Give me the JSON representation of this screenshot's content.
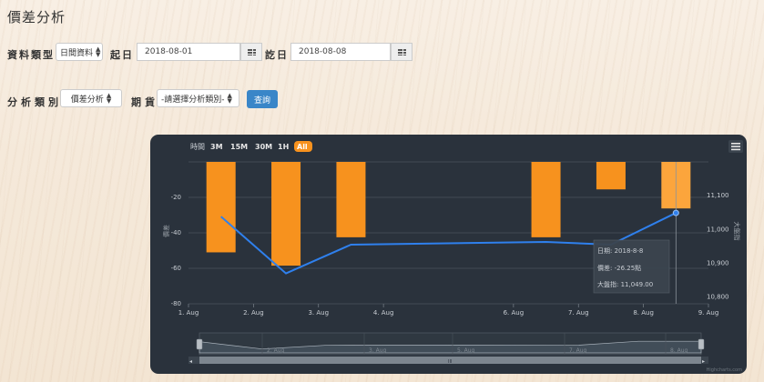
{
  "page": {
    "title": "價差分析"
  },
  "form": {
    "row1": {
      "data_type_label": "資料類型",
      "data_type_value": "日間資料",
      "start_label": "起日",
      "start_value": "2018-08-01",
      "end_label": "訖日",
      "end_value": "2018-08-08"
    },
    "row2": {
      "category_label": "分析類別",
      "category_value": "價差分析",
      "futures_label": "期貨",
      "futures_value": "-請選擇分析類別-",
      "query_label": "查詢"
    }
  },
  "colors": {
    "chart_bg": "#2a323c",
    "bar": "#f7921e",
    "bar_highlight": "#fca53c",
    "line": "#2f80ed",
    "button": "#3a86c8",
    "range_active": "#f7921e"
  },
  "chart": {
    "range_label": "時間",
    "range_buttons": [
      "3M",
      "15M",
      "30M",
      "1H",
      "All"
    ],
    "menu_icon": "hamburger-icon",
    "left_axis_title": "價差",
    "right_axis_title": "大盤指",
    "tooltip": {
      "line1": "日期: 2018-8-8",
      "line2": "價差: -26.25點",
      "line3": "大盤指: 11,049.00"
    },
    "navigator_ticks": [
      "2. Aug",
      "3. Aug",
      "5. Aug",
      "7. Aug",
      "8. Aug"
    ],
    "credit": "Highcharts.com"
  },
  "chart_data": {
    "type": "bar",
    "x_ticks": [
      "1. Aug",
      "2. Aug",
      "3. Aug",
      "4. Aug",
      "6. Aug",
      "7. Aug",
      "8. Aug",
      "9. Aug"
    ],
    "left_ticks": [
      "-20",
      "-40",
      "-60",
      "-80"
    ],
    "right_ticks": [
      "11,100",
      "11,000",
      "10,900",
      "10,800"
    ],
    "ylim": [
      -80,
      0
    ],
    "y2lim": [
      10780,
      11200
    ],
    "series": [
      {
        "name": "價差",
        "type": "column",
        "x": [
          "2018-08-01",
          "2018-08-02",
          "2018-08-03",
          "2018-08-06",
          "2018-08-07",
          "2018-08-08"
        ],
        "values": [
          -51,
          -58.5,
          -42.5,
          -42.5,
          -15.5,
          -26.25
        ]
      },
      {
        "name": "大盤指",
        "type": "line",
        "x": [
          "2018-08-01",
          "2018-08-02",
          "2018-08-03",
          "2018-08-06",
          "2018-08-07",
          "2018-08-08"
        ],
        "values": [
          11038,
          10870,
          10955,
          10963,
          10955,
          11049
        ]
      }
    ],
    "highlight_index": 5
  }
}
